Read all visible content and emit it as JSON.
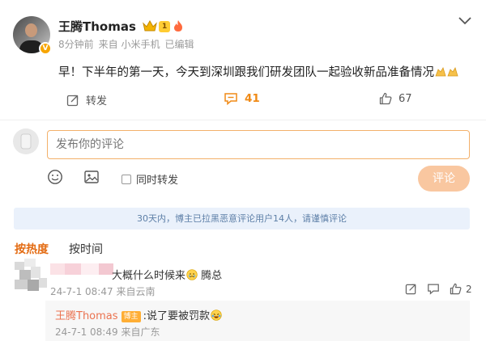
{
  "post": {
    "author": "王腾Thomas",
    "level": "1",
    "verified_mark": "V",
    "time": "8分钟前",
    "source": "来自 小米手机",
    "edited": "已编辑",
    "text": "早！下半年的第一天，今天到深圳跟我们研发团队一起验收新品准备情况",
    "reactions": [
      "clap-emoji",
      "clap-emoji"
    ],
    "actions": {
      "repost_label": "转发",
      "comment_count": "41",
      "like_count": "67"
    }
  },
  "composer": {
    "placeholder": "发布你的评论",
    "repost_checkbox_label": "同时转发",
    "submit_label": "评论"
  },
  "notice": "30天内，博主已拉黑恶意评论用户14人，请谨慎评论",
  "sort_tabs": {
    "hot": "按热度",
    "time": "按时间"
  },
  "comments": [
    {
      "text": "大概什么时候来",
      "suffix": "腾总",
      "time": "24-7-1 08:47",
      "location": "来自云南",
      "like_count": "2",
      "replies": [
        {
          "author": "王腾Thomas",
          "badge": "博主",
          "text": ":说了要被罚款",
          "time": "24-7-1 08:49",
          "location": "来自广东"
        }
      ]
    }
  ],
  "colors": {
    "accent": "#f08a16",
    "hot_tab": "#e36b12",
    "reply_name": "#eb7350",
    "notice_bg": "#eaf1fb",
    "notice_text": "#5d7fa7",
    "submit_bg": "#f9c7a0"
  },
  "icons": {
    "chevron": "chevron-down-icon",
    "repost": "repost-icon",
    "comment": "comment-icon",
    "like": "thumb-up-icon",
    "emoji": "emoji-icon",
    "image": "image-icon"
  }
}
